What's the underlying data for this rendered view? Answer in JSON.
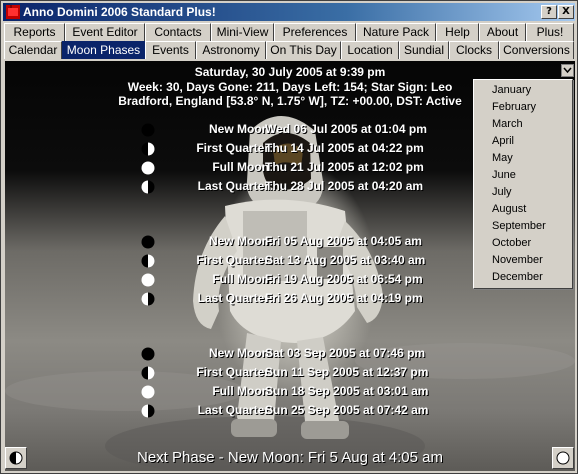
{
  "window": {
    "title": "Anno Domini 2006 Standard Plus!"
  },
  "titlebar_buttons": {
    "help": "?",
    "close": "X"
  },
  "tabs_row1": [
    {
      "label": "Reports"
    },
    {
      "label": "Event Editor"
    },
    {
      "label": "Contacts"
    },
    {
      "label": "Mini-View"
    },
    {
      "label": "Preferences"
    },
    {
      "label": "Nature Pack"
    },
    {
      "label": "Help"
    },
    {
      "label": "About"
    },
    {
      "label": "Plus!"
    }
  ],
  "tabs_row2": [
    {
      "label": "Calendar"
    },
    {
      "label": "Moon Phases",
      "active": true
    },
    {
      "label": "Events"
    },
    {
      "label": "Astronomy"
    },
    {
      "label": "On This Day"
    },
    {
      "label": "Location"
    },
    {
      "label": "Sundial"
    },
    {
      "label": "Clocks"
    },
    {
      "label": "Conversions"
    }
  ],
  "info": {
    "date_line": "Saturday, 30 July 2005 at 9:39 pm",
    "week_line": "Week: 30, Days Gone: 211, Days Left: 154; Star Sign: Leo",
    "location_line": "Bradford, England [53.8° N, 1.75° W], TZ: +00.00, DST: Active"
  },
  "phases": [
    {
      "name": "New Moon:",
      "date": "Wed  06  Jul  2005  at  01:04 pm",
      "icon": "new-moon"
    },
    {
      "name": "First Quarter:",
      "date": "Thu  14  Jul  2005  at  04:22 pm",
      "icon": "first-quarter"
    },
    {
      "name": "Full Moon:",
      "date": "Thu  21  Jul  2005  at  12:02 pm",
      "icon": "full-moon"
    },
    {
      "name": "Last Quarter:",
      "date": "Thu  28  Jul  2005  at  04:20 am",
      "icon": "last-quarter"
    },
    {
      "name": "New Moon:",
      "date": "Fri  05  Aug  2005  at  04:05 am",
      "icon": "new-moon"
    },
    {
      "name": "First Quarter:",
      "date": "Sat  13  Aug  2005  at  03:40 am",
      "icon": "first-quarter"
    },
    {
      "name": "Full Moon:",
      "date": "Fri  19  Aug  2005  at  06:54 pm",
      "icon": "full-moon"
    },
    {
      "name": "Last Quarter:",
      "date": "Fri  26  Aug  2005  at  04:19 pm",
      "icon": "last-quarter"
    },
    {
      "name": "New Moon:",
      "date": "Sat  03  Sep  2005  at  07:46 pm",
      "icon": "new-moon"
    },
    {
      "name": "First Quarter:",
      "date": "Sun  11  Sep  2005  at  12:37 pm",
      "icon": "first-quarter"
    },
    {
      "name": "Full Moon:",
      "date": "Sun  18  Sep  2005  at  03:01 am",
      "icon": "full-moon"
    },
    {
      "name": "Last Quarter:",
      "date": "Sun  25  Sep  2005  at  07:42 am",
      "icon": "last-quarter"
    }
  ],
  "month_menu": {
    "items": [
      "January",
      "February",
      "March",
      "April",
      "May",
      "June",
      "July",
      "August",
      "September",
      "October",
      "November",
      "December"
    ]
  },
  "next_phase": "Next Phase - New Moon:  Fri  5  Aug  at  4:05 am",
  "colors": {
    "title_bar": "#0a246a",
    "active_tab": "#0a246a",
    "text_overlay": "#ffffff",
    "chrome": "#d4d0c8"
  }
}
